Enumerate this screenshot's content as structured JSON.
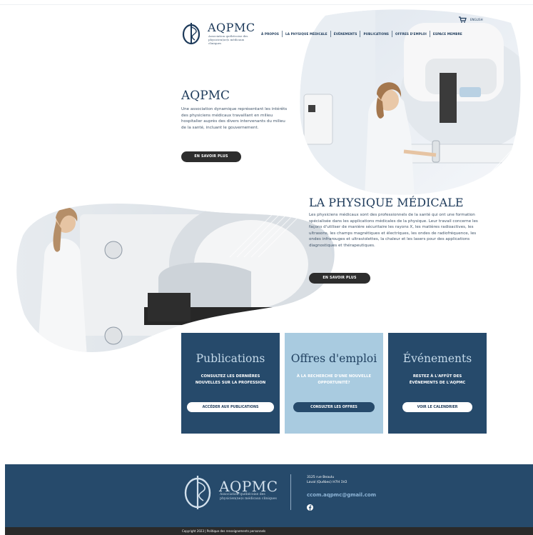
{
  "header": {
    "logo_name": "AQPMC",
    "logo_subtitle": "Association québécoise des physicien(ne)s médicaux cliniques",
    "nav": [
      "À PROPOS",
      "LA PHYSIQUE MÉDICALE",
      "ÉVÉNEMENTS",
      "PUBLICATIONS",
      "OFFRES D'EMPLOI",
      "ESPACE MEMBRE"
    ],
    "language_link": "ENGLISH",
    "cart_icon": "cart-icon"
  },
  "intro": {
    "title": "AQPMC",
    "text": "Une association dynamique représentant les intérêts des physiciens médicaux travaillant en milieu hospitalier auprès des divers intervenants du milieu de la santé, incluant le gouvernement.",
    "button": "EN SAVOIR PLUS"
  },
  "physique": {
    "title": "LA PHYSIQUE MÉDICALE",
    "text": "Les physiciens médicaux sont des professionnels de la santé qui ont une formation spécialisée dans les applications médicales de la physique. Leur travail concerne les façons d'utiliser de manière sécuritaire les rayons X, les matières radioactives, les ultrasons, les champs magnétiques et électriques, les ondes de radiofréquence, les ondes infrarouges et ultraviolettes, la chaleur et les lasers pour des applications diagnostiques et thérapeutiques.",
    "button": "EN SAVOIR PLUS"
  },
  "cards": [
    {
      "title": "Publications",
      "text": "CONSULTEZ LES DERNIÈRES NOUVELLES SUR LA PROFESSION",
      "button": "ACCÉDER AUX PUBLICATIONS"
    },
    {
      "title": "Offres d'emploi",
      "text": "À LA RECHERCHE D'UNE NOUVELLE OPPORTUNITÉ?",
      "button": "CONSULTER LES OFFRES"
    },
    {
      "title": "Événements",
      "text": "RESTEZ À L'AFFÛT DES ÉVÉNEMENTS DE L'AQPMC",
      "button": "VOIR LE CALENDRIER"
    }
  ],
  "footer": {
    "logo_name": "AQPMC",
    "logo_subtitle": "Association québécoise des physicien(ne)s médicaux cliniques",
    "address_line1": "3125 rue Beaulu",
    "address_line2": "Laval (Québec) H7H 1V2",
    "email": "ccom.aqpmc@gmail.com",
    "social_icon": "facebook-icon",
    "copyright": "Copyright 2023 | Politique des renseignements personnels"
  },
  "colors": {
    "navy": "#264a6b",
    "light_blue": "#a9cbe0",
    "dark_button": "#2d2d2d",
    "footer_bottom": "#2a2a2a"
  }
}
